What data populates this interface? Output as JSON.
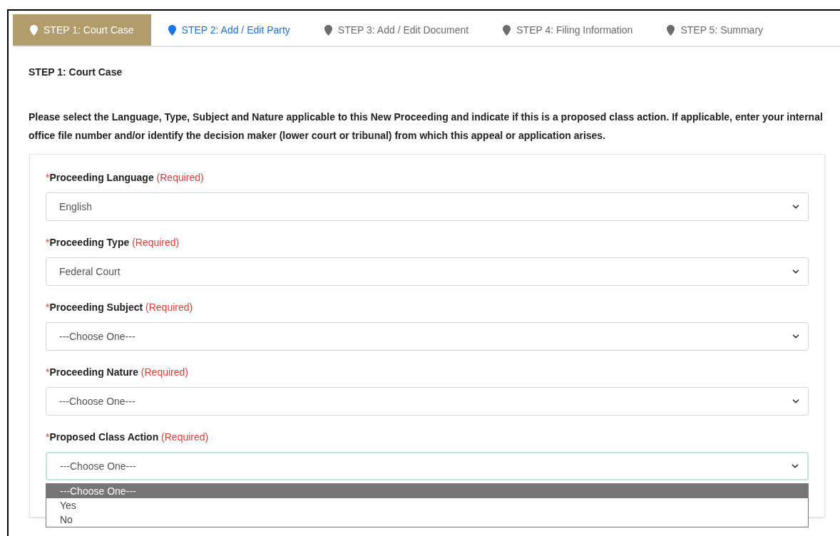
{
  "tabs": [
    {
      "label": "STEP 1: Court Case",
      "selected": true,
      "enabled": true
    },
    {
      "label": "STEP 2: Add / Edit Party",
      "selected": false,
      "enabled": true
    },
    {
      "label": "STEP 3: Add / Edit Document",
      "selected": false,
      "enabled": false
    },
    {
      "label": "STEP 4: Filing Information",
      "selected": false,
      "enabled": false
    },
    {
      "label": "STEP 5: Summary",
      "selected": false,
      "enabled": false
    }
  ],
  "heading": "STEP 1: Court Case",
  "instructions": "Please select the Language, Type, Subject and Nature applicable to this New Proceeding and indicate if this is a proposed class action. If applicable, enter your internal office file number and/or identify the decision maker (lower court or tribunal) from which this appeal or application arises.",
  "fields": [
    {
      "marker": "*",
      "label": "Proceeding Language",
      "required": "(Required)",
      "value": "English",
      "focused": false
    },
    {
      "marker": "*",
      "label": "Proceeding Type",
      "required": "(Required)",
      "value": "Federal Court",
      "focused": false
    },
    {
      "marker": "*",
      "label": "Proceeding Subject",
      "required": "(Required)",
      "value": "---Choose One---",
      "focused": false
    },
    {
      "marker": "*",
      "label": "Proceeding Nature",
      "required": "(Required)",
      "value": "---Choose One---",
      "focused": false
    },
    {
      "marker": "*",
      "label": "Proposed Class Action",
      "required": "(Required)",
      "value": "---Choose One---",
      "focused": true,
      "options": [
        {
          "label": "---Choose One---",
          "selected": true
        },
        {
          "label": "Yes",
          "selected": false
        },
        {
          "label": "No",
          "selected": false
        }
      ]
    }
  ]
}
